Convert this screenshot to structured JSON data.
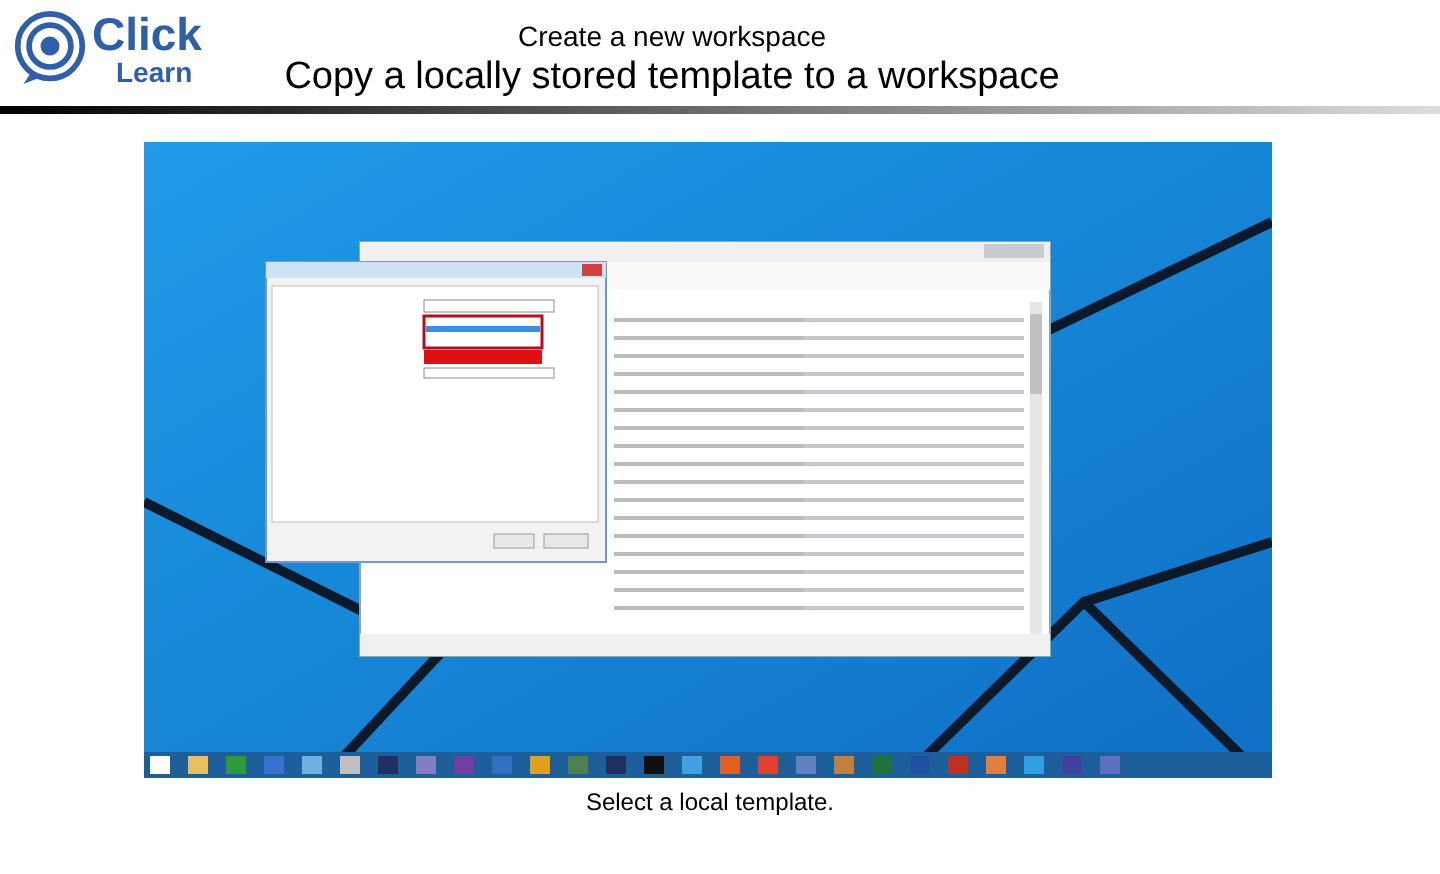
{
  "logo": {
    "word_1": "Click",
    "word_2": "Learn"
  },
  "header": {
    "title": "Create a new workspace",
    "subtitle": "Copy a locally stored template to a workspace"
  },
  "screenshot": {
    "kind": "screenshot"
  },
  "caption": "Select a local template."
}
